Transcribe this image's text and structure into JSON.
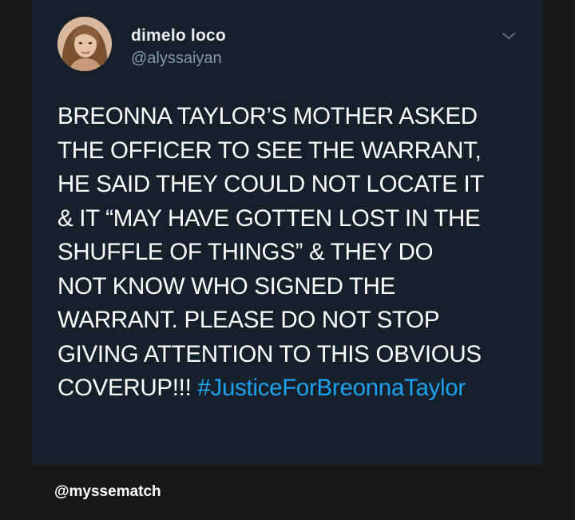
{
  "tweet": {
    "display_name": "dimelo loco",
    "handle": "@alyssaiyan",
    "menu_icon": "chevron-down-icon",
    "avatar_icon": "profile-photo",
    "text_lines": [
      "BREONNA TAYLOR’S MOTHER ASKED",
      "THE OFFICER TO SEE THE WARRANT,",
      "HE SAID THEY COULD NOT LOCATE IT",
      "& IT “MAY HAVE GOTTEN LOST IN THE",
      "SHUFFLE OF THINGS” & THEY DO",
      "NOT KNOW WHO SIGNED THE",
      "WARRANT. PLEASE DO NOT STOP",
      "GIVING ATTENTION TO THIS OBVIOUS"
    ],
    "last_line_text": "COVERUP!!!",
    "hashtag": "#JusticeForBreonnaTaylor"
  },
  "watermark": "@myssematch",
  "colors": {
    "background": "#17171a",
    "card": "#15202b",
    "text": "#ffffff",
    "secondary_text": "#8b98a5",
    "hashtag": "#1da1f2"
  }
}
